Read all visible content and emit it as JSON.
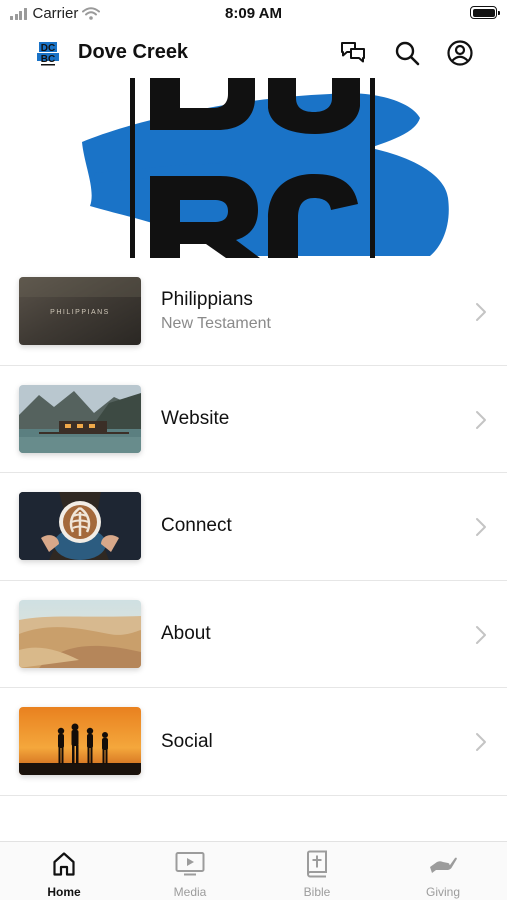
{
  "status_bar": {
    "carrier": "Carrier",
    "time": "8:09 AM"
  },
  "header": {
    "title": "Dove Creek",
    "logo_text": "DCBC"
  },
  "colors": {
    "accent": "#1a73c7",
    "text": "#111111",
    "muted": "#8a8a8a"
  },
  "list": {
    "items": [
      {
        "title": "Philippians",
        "subtitle": "New Testament",
        "thumb_text": "PHILIPPIANS",
        "thumb": "philippians-image"
      },
      {
        "title": "Website",
        "subtitle": "",
        "thumb": "lake-cabin-image"
      },
      {
        "title": "Connect",
        "subtitle": "",
        "thumb": "coffee-cup-image"
      },
      {
        "title": "About",
        "subtitle": "",
        "thumb": "desert-dunes-image"
      },
      {
        "title": "Social",
        "subtitle": "",
        "thumb": "sunset-family-image"
      }
    ]
  },
  "tabbar": {
    "tabs": [
      {
        "label": "Home",
        "icon": "home-icon",
        "active": true
      },
      {
        "label": "Media",
        "icon": "media-icon",
        "active": false
      },
      {
        "label": "Bible",
        "icon": "bible-icon",
        "active": false
      },
      {
        "label": "Giving",
        "icon": "giving-icon",
        "active": false
      }
    ]
  }
}
